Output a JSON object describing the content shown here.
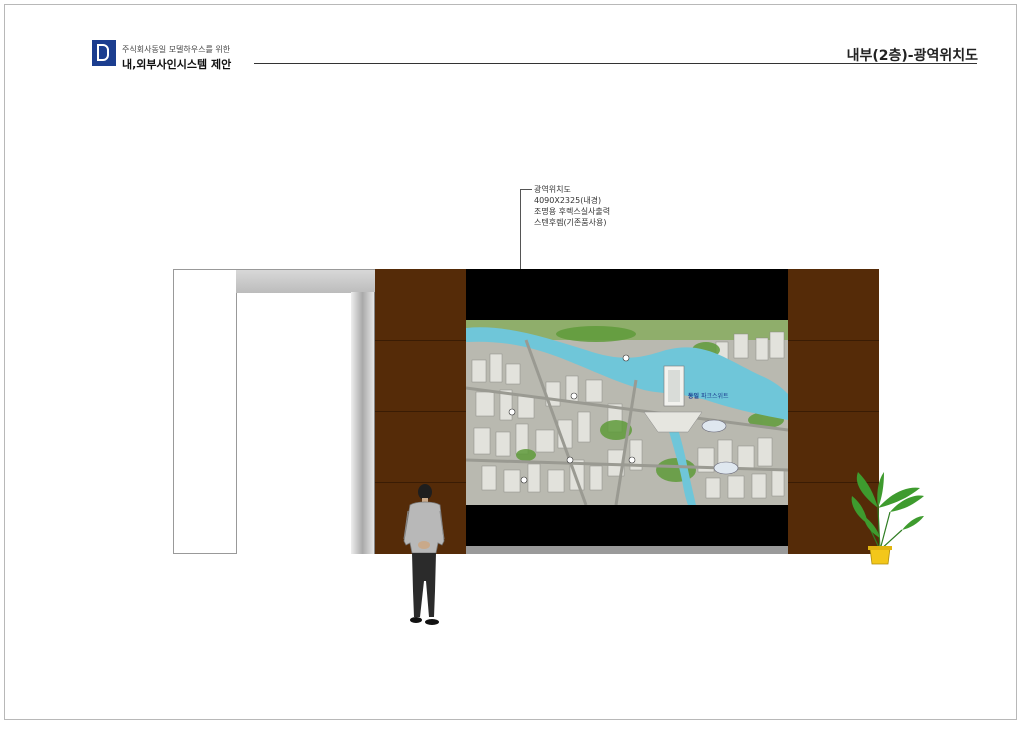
{
  "header": {
    "company": "주식회사동일 모델하우스를 위한",
    "doc_title": "내,외부사인시스템 제안",
    "page_title": "내부(2층)-광역위치도"
  },
  "callout": {
    "line1": "광역위치도",
    "line2": "4090X2325(내경)",
    "line3": "조명용 후렉스실사출력",
    "line4": "스텐후렘(기존품사용)"
  },
  "map": {
    "label_brand": "동일",
    "label_name": "파크스위트"
  },
  "colors": {
    "logo": "#1b3d8f",
    "wood": "#552b08",
    "river": "#6fc6d9"
  }
}
